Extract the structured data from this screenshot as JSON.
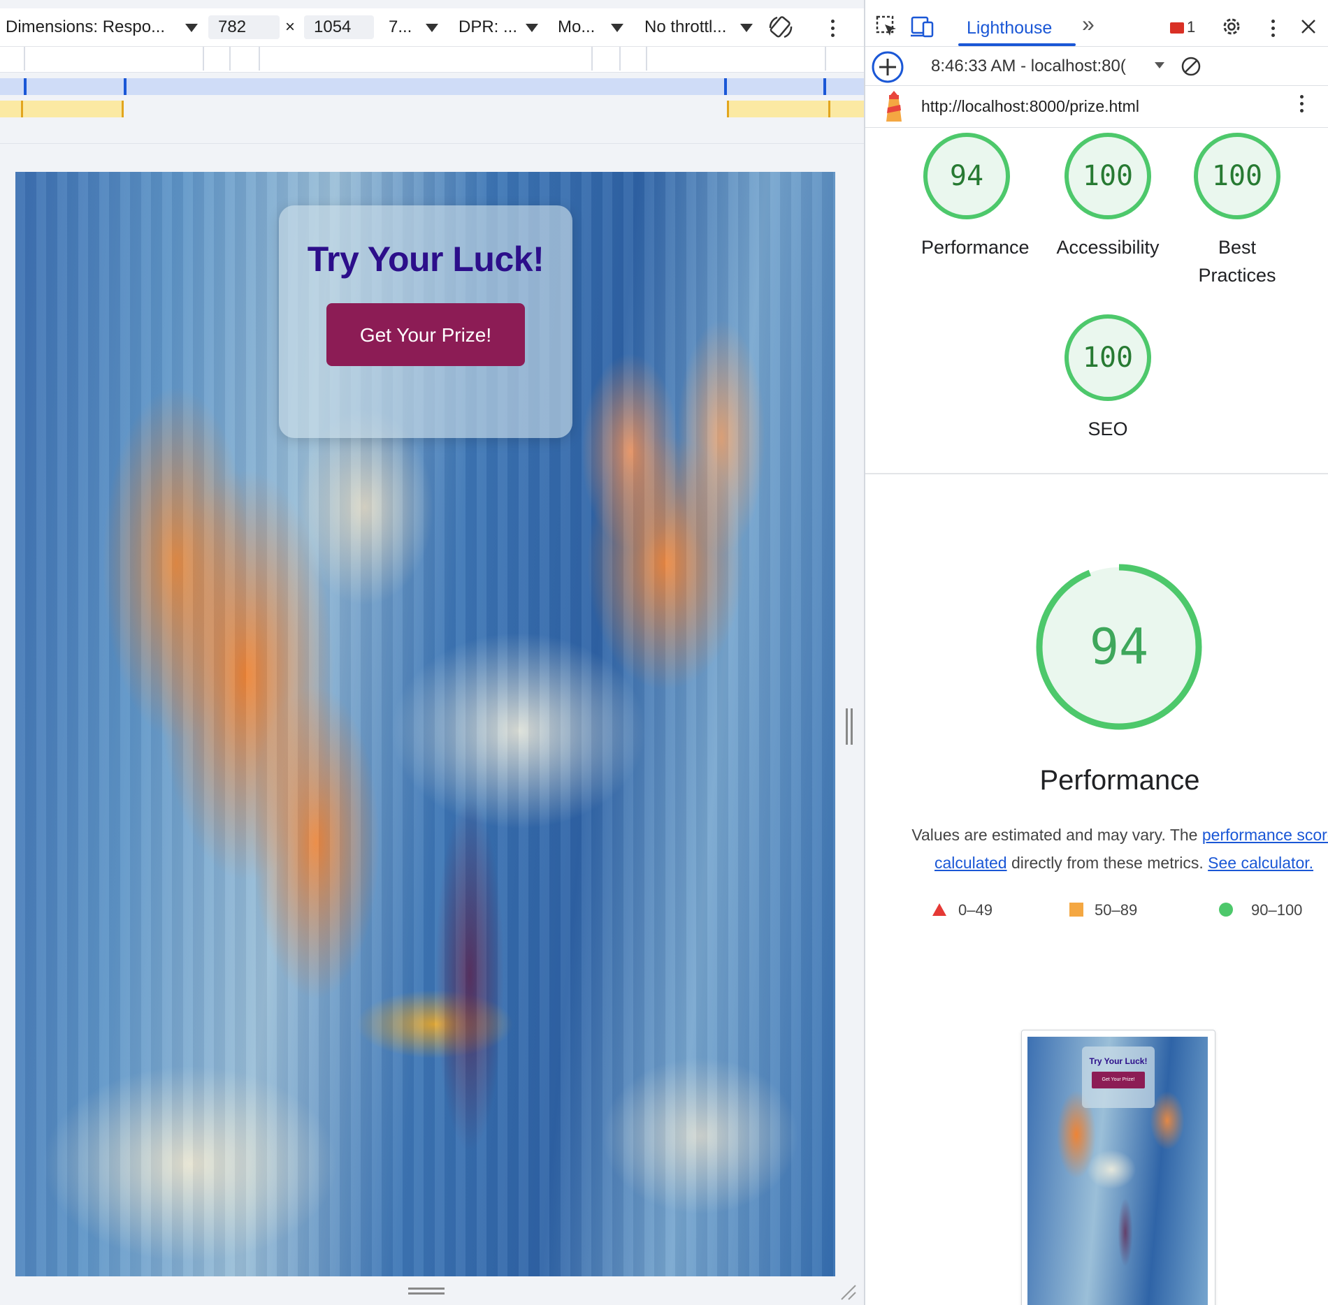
{
  "device_toolbar": {
    "dimensions_label": "Dimensions: Respo...",
    "width_value": "782",
    "times_sign": "×",
    "height_value": "1054",
    "zoom_label": "7...",
    "dpr_label": "DPR: ...",
    "mobile_label": "Mo...",
    "throttle_label": "No throttl..."
  },
  "page": {
    "card_title": "Try Your Luck!",
    "button_label": "Get Your Prize!",
    "button_color": "#8c1c55",
    "title_color": "#2c0e8a"
  },
  "devtools": {
    "active_tab": "Lighthouse",
    "more_tabs_glyph": "»",
    "error_count": "1",
    "report_time": "8:46:33 AM - localhost:80(",
    "report_url": "http://localhost:8000/prize.html"
  },
  "scores": [
    {
      "value": "94",
      "label": "Performance"
    },
    {
      "value": "100",
      "label": "Accessibility"
    },
    {
      "value": "100",
      "label": "Best Practices"
    },
    {
      "value": "100",
      "label": "SEO"
    }
  ],
  "performance": {
    "score": "94",
    "title": "Performance",
    "desc_prefix": "Values are estimated and may vary. The ",
    "desc_link1": "performance score",
    "desc_line2_link": "calculated",
    "desc_middle": " directly from these metrics. ",
    "desc_link2": "See calculator.",
    "legend": [
      {
        "range": "0–49",
        "color": "#e53935"
      },
      {
        "range": "50–89",
        "color": "#f4a742"
      },
      {
        "range": "90–100",
        "color": "#4dc86b"
      }
    ]
  },
  "thumbnail": {
    "title": "Try Your Luck!",
    "button": "Get Your Prize!"
  }
}
